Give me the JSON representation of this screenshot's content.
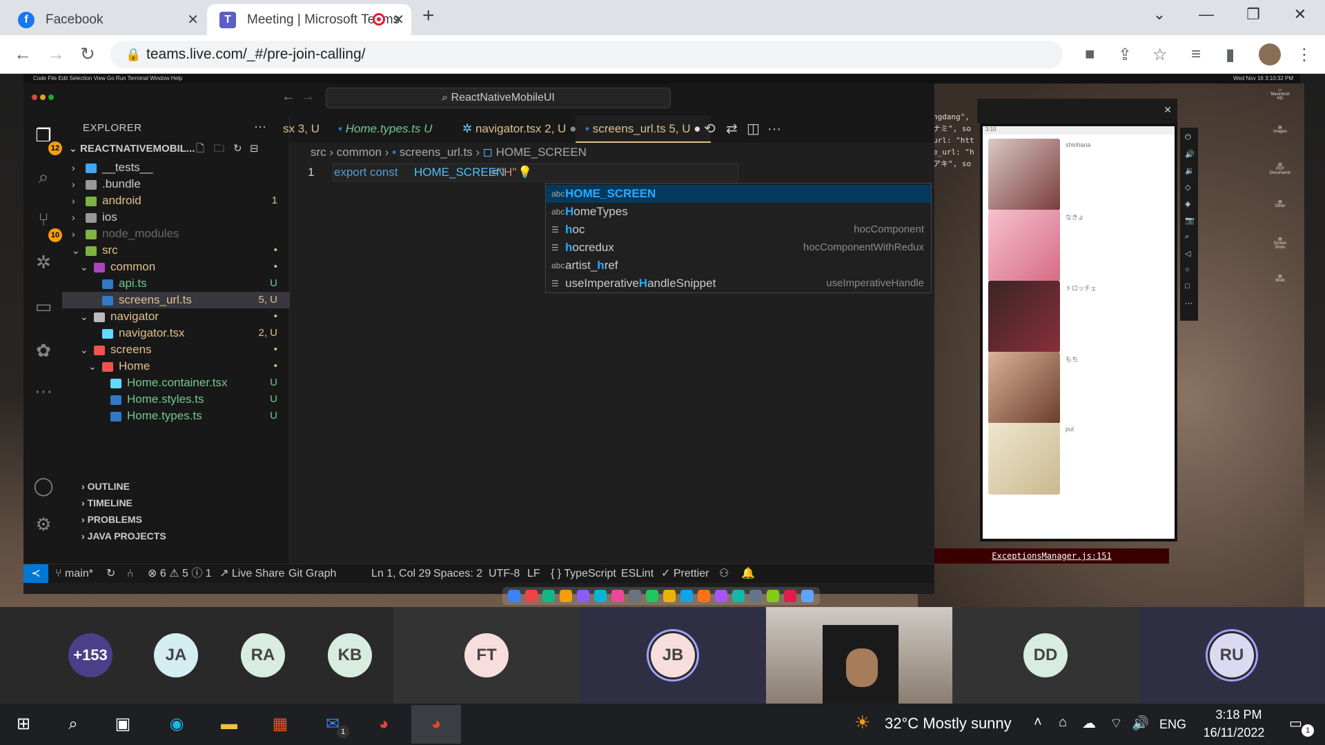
{
  "browser": {
    "tabs": [
      {
        "title": "Facebook",
        "favicon": "facebook-icon"
      },
      {
        "title": "Meeting | Microsoft Teams",
        "favicon": "teams-icon",
        "recording": true
      }
    ],
    "new_tab": "+",
    "url": "teams.live.com/_#/pre-join-calling/"
  },
  "vscode": {
    "command_center": "ReactNativeMobileUI",
    "explorer_title": "EXPLORER",
    "project": "REACTNATIVEMOBIL...",
    "badges": {
      "explorer": "12",
      "scm": "10"
    },
    "tree": [
      {
        "label": "__tests__",
        "stat": "",
        "color": "#cccccc"
      },
      {
        "label": ".bundle",
        "stat": "",
        "color": "#cccccc"
      },
      {
        "label": "android",
        "stat": "1",
        "color": "#e2c08d"
      },
      {
        "label": "ios",
        "stat": "",
        "color": "#cccccc"
      },
      {
        "label": "node_modules",
        "stat": "",
        "color": "#6b6b6b"
      },
      {
        "label": "src",
        "stat": "•",
        "color": "#e2c08d"
      },
      {
        "label": "common",
        "stat": "•",
        "color": "#e2c08d"
      },
      {
        "label": "api.ts",
        "stat": "U",
        "color": "#73c991"
      },
      {
        "label": "screens_url.ts",
        "stat": "5, U",
        "color": "#e2c08d"
      },
      {
        "label": "navigator",
        "stat": "•",
        "color": "#e2c08d"
      },
      {
        "label": "navigator.tsx",
        "stat": "2, U",
        "color": "#e2c08d"
      },
      {
        "label": "screens",
        "stat": "•",
        "color": "#e2c08d"
      },
      {
        "label": "Home",
        "stat": "•",
        "color": "#e2c08d"
      },
      {
        "label": "Home.container.tsx",
        "stat": "U",
        "color": "#73c991"
      },
      {
        "label": "Home.styles.ts",
        "stat": "U",
        "color": "#73c991"
      },
      {
        "label": "Home.types.ts",
        "stat": "U",
        "color": "#73c991"
      }
    ],
    "sections": [
      "OUTLINE",
      "TIMELINE",
      "PROBLEMS",
      "JAVA PROJECTS"
    ],
    "editor_tabs": [
      {
        "name": "sx",
        "status": "3, U"
      },
      {
        "name": "Home.types.ts",
        "status": "U"
      },
      {
        "name": "navigator.tsx",
        "status": "2, U"
      },
      {
        "name": "screens_url.ts",
        "status": "5, U"
      }
    ],
    "breadcrumb": [
      "src",
      "common",
      "screens_url.ts",
      "HOME_SCREEN"
    ],
    "line_number": "1",
    "code": {
      "keyword": "export const",
      "name": "HOME_SCREEN",
      "op": "=",
      "value": "\"H\""
    },
    "suggestions": [
      {
        "kind": "abc",
        "pre": "",
        "match": "H",
        "post": "OME_SCREEN",
        "detail": ""
      },
      {
        "kind": "abc",
        "pre": "",
        "match": "H",
        "post": "omeTypes",
        "detail": ""
      },
      {
        "kind": "☰",
        "pre": "",
        "match": "h",
        "post": "oc",
        "detail": "hocComponent"
      },
      {
        "kind": "☰",
        "pre": "",
        "match": "h",
        "post": "ocredux",
        "detail": "hocComponentWithRedux"
      },
      {
        "kind": "abc",
        "pre": "artist_",
        "match": "h",
        "post": "ref",
        "detail": ""
      },
      {
        "kind": "☰",
        "pre": "useImperative",
        "match": "H",
        "post": "andleSnippet",
        "detail": "useImperativeHandle"
      }
    ],
    "status": {
      "branch": "main*",
      "problems": "⊗ 6 ⚠ 5 ⓘ 1",
      "live_share": "Live Share",
      "git_graph": "Git Graph",
      "position": "Ln 1, Col 29",
      "spaces": "Spaces: 2",
      "encoding": "UTF-8",
      "eol": "LF",
      "language": "{ } TypeScript",
      "eslint": "ESLint",
      "prettier": "Prettier"
    }
  },
  "emulator": {
    "time": "3:10",
    "items": [
      "shiohana",
      "なきょ",
      "トロッチェ",
      "もち",
      "pul"
    ],
    "exception": "ExceptionsManager.js:151"
  },
  "mac_menu": "Code  File  Edit  Selection  View  Go  Run  Terminal  Window  Help",
  "mac_clock": "Wed Nov 16  3:10:32 PM",
  "participants": [
    {
      "initials": "+153",
      "bg": "#4b3f8a",
      "fg": "#ffffff"
    },
    {
      "initials": "JA",
      "bg": "#d5ecf2",
      "fg": "#444444"
    },
    {
      "initials": "RA",
      "bg": "#d8ecdf",
      "fg": "#444444"
    },
    {
      "initials": "KB",
      "bg": "#d8ecdf",
      "fg": "#444444"
    },
    {
      "initials": "FT",
      "bg": "#f7dedc",
      "fg": "#444444"
    },
    {
      "initials": "JB",
      "bg": "#f7dedc",
      "fg": "#444444"
    },
    {
      "initials": "DD",
      "bg": "#d8ecdf",
      "fg": "#444444"
    },
    {
      "initials": "RU",
      "bg": "#dcd9f2",
      "fg": "#444444"
    }
  ],
  "taskbar": {
    "weather": "32°C  Mostly sunny",
    "lang": "ENG",
    "time": "3:18 PM",
    "date": "16/11/2022",
    "notif": "1",
    "mail_badge": "1"
  }
}
